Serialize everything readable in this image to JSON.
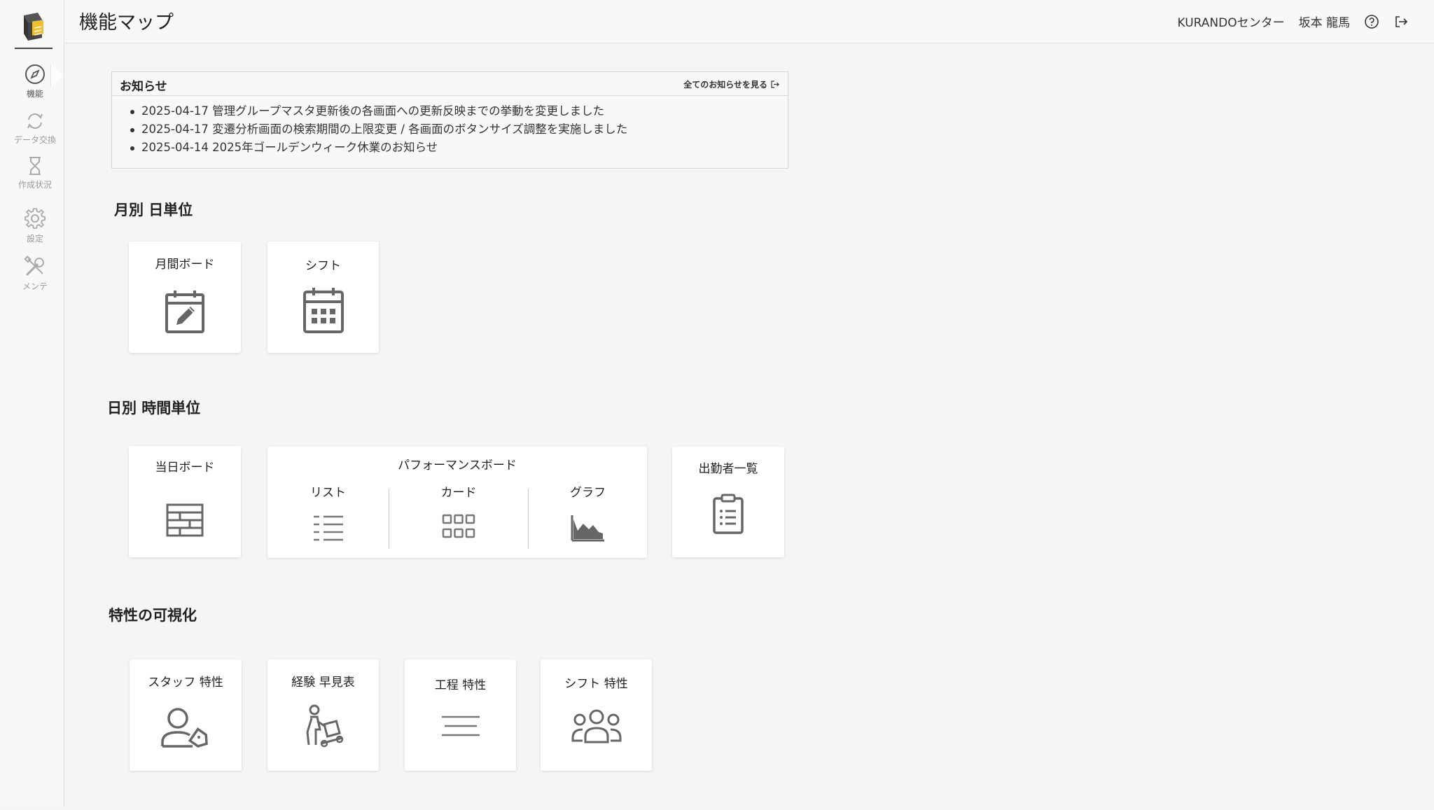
{
  "sidebar": {
    "items": [
      {
        "label": "機能",
        "icon": "compass-icon"
      },
      {
        "label": "データ交換",
        "icon": "sync-icon"
      },
      {
        "label": "作成状況",
        "icon": "hourglass-icon"
      },
      {
        "label": "設定",
        "icon": "gear-icon"
      },
      {
        "label": "メンテ",
        "icon": "tools-icon"
      }
    ]
  },
  "header": {
    "title": "機能マップ",
    "center_name": "KURANDOセンター",
    "user_name": "坂本 龍馬"
  },
  "notice": {
    "title": "お知らせ",
    "view_all": "全てのお知らせを見る",
    "items": [
      "2025-04-17 管理グループマスタ更新後の各画面への更新反映までの挙動を変更しました",
      "2025-04-17 変遷分析画面の検索期間の上限変更 / 各画面のボタンサイズ調整を実施しました",
      "2025-04-14 2025年ゴールデンウィーク休業のお知らせ"
    ]
  },
  "sections": {
    "monthly": {
      "title": "月別 日単位",
      "cards": [
        {
          "label": "月間ボード",
          "icon": "calendar-edit-icon"
        },
        {
          "label": "シフト",
          "icon": "calendar-grid-icon"
        }
      ]
    },
    "daily": {
      "title": "日別 時間単位",
      "today_board": {
        "label": "当日ボード",
        "icon": "table-icon"
      },
      "performance": {
        "label": "パフォーマンスボード",
        "subs": [
          {
            "label": "リスト",
            "icon": "list-icon"
          },
          {
            "label": "カード",
            "icon": "card-grid-icon"
          },
          {
            "label": "グラフ",
            "icon": "area-chart-icon"
          }
        ]
      },
      "attendance": {
        "label": "出勤者一覧",
        "icon": "clipboard-list-icon"
      }
    },
    "traits": {
      "title": "特性の可視化",
      "cards": [
        {
          "label": "スタッフ 特性",
          "icon": "person-tag-icon"
        },
        {
          "label": "経験 早見表",
          "icon": "worker-cart-icon"
        },
        {
          "label": "工程 特性",
          "icon": "lines-icon"
        },
        {
          "label": "シフト 特性",
          "icon": "group-icon"
        }
      ]
    }
  }
}
